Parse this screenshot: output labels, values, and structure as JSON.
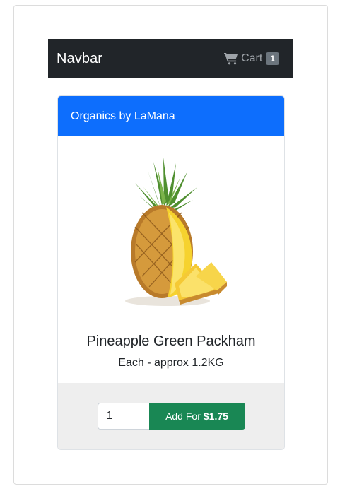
{
  "navbar": {
    "brand": "Navbar",
    "cart_label": "Cart",
    "cart_count": "1"
  },
  "card": {
    "header": "Organics by LaMana",
    "product_name": "Pineapple Green Packham",
    "product_desc": "Each - approx 1.2KG",
    "image_icon": "pineapple-image",
    "quantity": "1",
    "add_label": "Add For",
    "price": "$1.75"
  },
  "colors": {
    "navbar_bg": "#212529",
    "header_bg": "#0d6efd",
    "button_bg": "#198754",
    "footer_bg": "#eeeeee"
  }
}
